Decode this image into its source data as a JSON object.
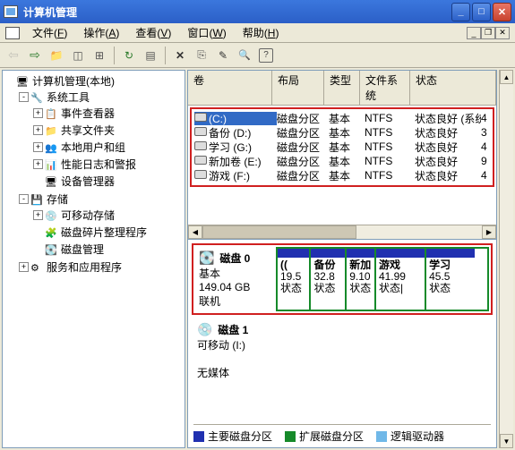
{
  "window": {
    "title": "计算机管理"
  },
  "menu": {
    "file": "文件",
    "file_key": "F",
    "action": "操作",
    "action_key": "A",
    "view": "查看",
    "view_key": "V",
    "window_m": "窗口",
    "window_key": "W",
    "help": "帮助",
    "help_key": "H"
  },
  "tree": {
    "root": "计算机管理(本地)",
    "systools": "系统工具",
    "eventviewer": "事件查看器",
    "sharedfolders": "共享文件夹",
    "usersgroups": "本地用户和组",
    "perflogs": "性能日志和警报",
    "devmgr": "设备管理器",
    "storage": "存储",
    "removable": "可移动存储",
    "defrag": "磁盘碎片整理程序",
    "diskmgmt": "磁盘管理",
    "services": "服务和应用程序"
  },
  "vol_cols": {
    "volume": "卷",
    "layout": "布局",
    "type": "类型",
    "fs": "文件系统",
    "status": "状态"
  },
  "volumes": [
    {
      "name": "(C:)",
      "layout": "磁盘分区",
      "type": "基本",
      "fs": "NTFS",
      "status": "状态良好 (系统)",
      "tail": "4"
    },
    {
      "name": "备份 (D:)",
      "layout": "磁盘分区",
      "type": "基本",
      "fs": "NTFS",
      "status": "状态良好",
      "tail": "3"
    },
    {
      "name": "学习 (G:)",
      "layout": "磁盘分区",
      "type": "基本",
      "fs": "NTFS",
      "status": "状态良好",
      "tail": "4"
    },
    {
      "name": "新加卷 (E:)",
      "layout": "磁盘分区",
      "type": "基本",
      "fs": "NTFS",
      "status": "状态良好",
      "tail": "9"
    },
    {
      "name": "游戏 (F:)",
      "layout": "磁盘分区",
      "type": "基本",
      "fs": "NTFS",
      "status": "状态良好",
      "tail": "4"
    }
  ],
  "disk0": {
    "title": "磁盘 0",
    "type": "基本",
    "size": "149.04 GB",
    "online": "联机",
    "parts": [
      {
        "name": "((",
        "size": "19.5",
        "stat": "状态"
      },
      {
        "name": "备份",
        "size": "32.8",
        "stat": "状态"
      },
      {
        "name": "新加",
        "size": "9.10",
        "stat": "状态"
      },
      {
        "name": "游戏",
        "size": "41.99",
        "stat": "状态|"
      },
      {
        "name": "学习",
        "size": "45.5",
        "stat": "状态"
      }
    ]
  },
  "disk1": {
    "title": "磁盘 1",
    "type": "可移动 (I:)",
    "nomedia": "无媒体"
  },
  "legend": {
    "primary": "主要磁盘分区",
    "extended": "扩展磁盘分区",
    "logical": "逻辑驱动器"
  },
  "colors": {
    "primary": "#2030b0",
    "extended": "#168a2a",
    "logical": "#70b8e8"
  }
}
